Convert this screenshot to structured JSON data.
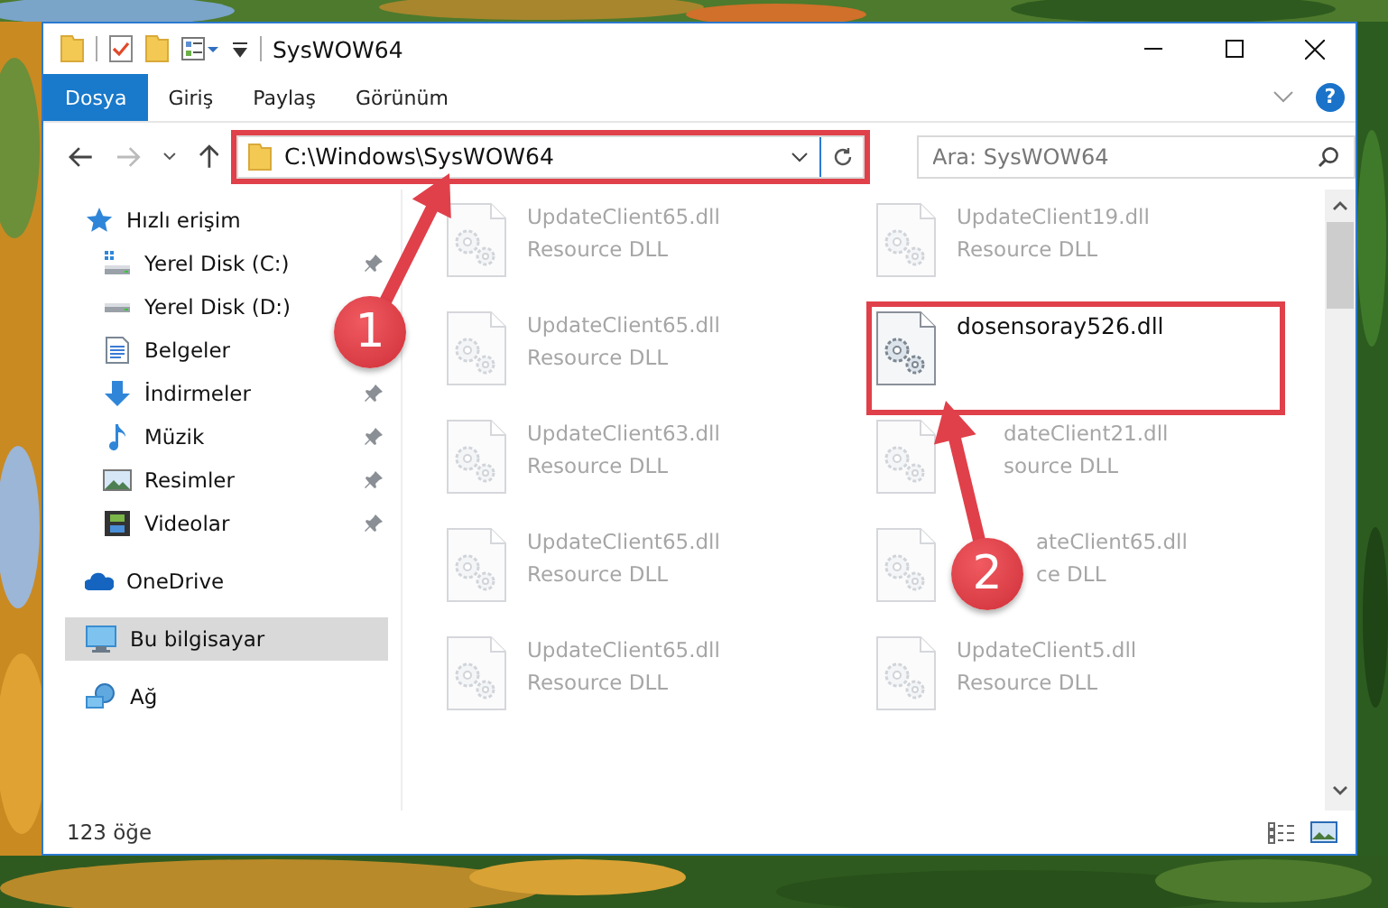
{
  "window": {
    "title": "SysWOW64"
  },
  "ribbon": {
    "tabs": [
      {
        "label": "Dosya",
        "selected": true
      },
      {
        "label": "Giriş",
        "selected": false
      },
      {
        "label": "Paylaş",
        "selected": false
      },
      {
        "label": "Görünüm",
        "selected": false
      }
    ],
    "help": "?"
  },
  "address": {
    "path": "C:\\Windows\\SysWOW64"
  },
  "search": {
    "placeholder": "Ara: SysWOW64"
  },
  "nav": [
    {
      "label": "Hızlı erişim",
      "kind": "star",
      "selected": false,
      "children": [
        {
          "label": "Yerel Disk (C:)",
          "kind": "system-drive",
          "pinned": true,
          "selected": false
        },
        {
          "label": "Yerel Disk (D:)",
          "kind": "drive",
          "pinned": false,
          "selected": false
        },
        {
          "label": "Belgeler",
          "kind": "documents",
          "pinned": false,
          "selected": false
        },
        {
          "label": "İndirmeler",
          "kind": "download",
          "pinned": true,
          "selected": false
        },
        {
          "label": "Müzik",
          "kind": "music",
          "pinned": true,
          "selected": false
        },
        {
          "label": "Resimler",
          "kind": "pictures",
          "pinned": true,
          "selected": false
        },
        {
          "label": "Videolar",
          "kind": "videos",
          "pinned": true,
          "selected": false
        }
      ]
    },
    {
      "label": "OneDrive",
      "kind": "cloud",
      "selected": false
    },
    {
      "label": "Bu bilgisayar",
      "kind": "computer",
      "selected": true
    },
    {
      "label": "Ağ",
      "kind": "network",
      "selected": false
    }
  ],
  "files": [
    {
      "name": "UpdateClient65.dll",
      "type": "Resource DLL",
      "highlighted": false
    },
    {
      "name": "UpdateClient19.dll",
      "type": "Resource DLL",
      "highlighted": false
    },
    {
      "name": "UpdateClient65.dll",
      "type": "Resource DLL",
      "highlighted": false
    },
    {
      "name": "dosensoray526.dll",
      "highlighted": true
    },
    {
      "name": "UpdateClient63.dll",
      "type": "Resource DLL",
      "highlighted": false
    },
    {
      "name": "dateClient21.dll",
      "type": "source DLL",
      "highlighted": false,
      "behind_arrow": true
    },
    {
      "name": "UpdateClient65.dll",
      "type": "Resource DLL",
      "highlighted": false
    },
    {
      "name": "ateClient65.dll",
      "type": "ce DLL",
      "highlighted": false,
      "behind_badge": true
    },
    {
      "name": "UpdateClient65.dll",
      "type": "Resource DLL",
      "highlighted": false
    },
    {
      "name": "UpdateClient5.dll",
      "type": "Resource DLL",
      "highlighted": false
    }
  ],
  "status_bar": {
    "count": "123 öğe"
  },
  "annotations": [
    {
      "number": "1"
    },
    {
      "number": "2"
    }
  ]
}
